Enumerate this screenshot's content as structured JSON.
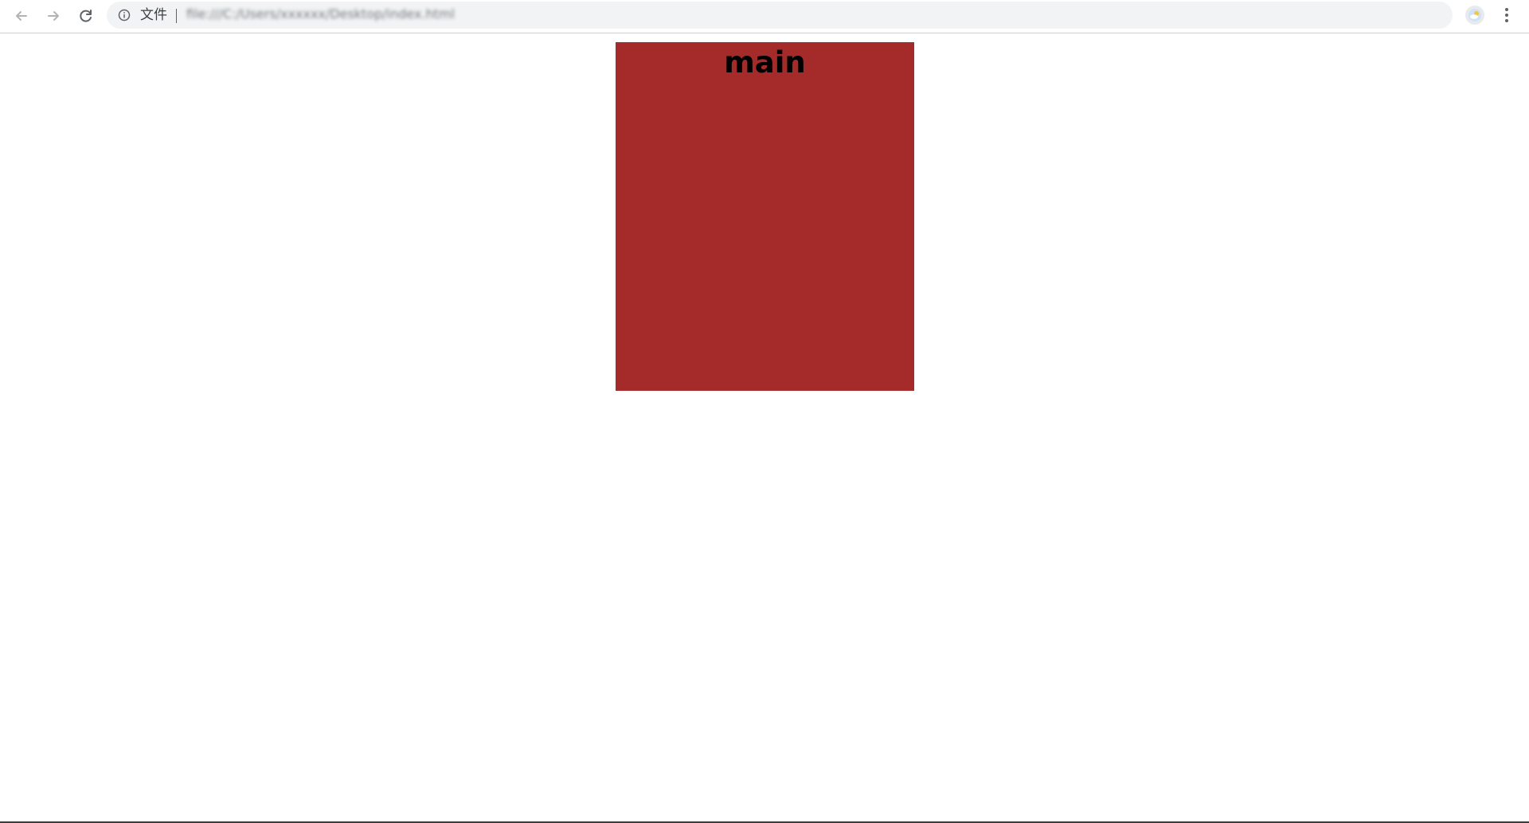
{
  "browser": {
    "address_bar": {
      "scheme_label": "文件",
      "url_text": "file:///C:/Users/xxxxxx/Desktop/index.html"
    },
    "icons": {
      "back": "back-arrow-icon",
      "forward": "forward-arrow-icon",
      "reload": "reload-icon",
      "info": "info-icon",
      "bookmark": "star-icon",
      "profile": "avatar",
      "menu": "kebab-menu-icon"
    }
  },
  "page": {
    "main_box": {
      "heading": "main",
      "background_color": "#a52a2a"
    }
  }
}
